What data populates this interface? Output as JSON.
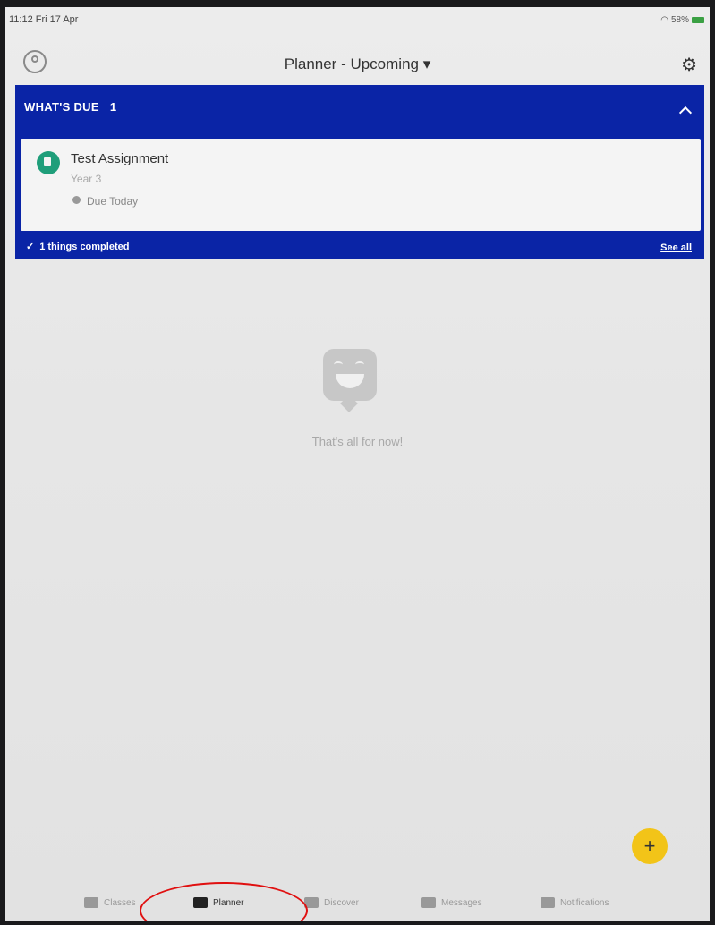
{
  "status_bar": {
    "time": "11:12  Fri 17 Apr",
    "battery": "58%"
  },
  "navbar": {
    "title": "Planner - Upcoming ▾"
  },
  "due_panel": {
    "header": "WHAT'S DUE",
    "count": "1",
    "item": {
      "title": "Test Assignment",
      "subtitle": "Year 3",
      "due": "Due Today"
    },
    "completed": "1 things completed",
    "see_all": "See all"
  },
  "empty_state": {
    "text": "That's all for now!"
  },
  "fab": {
    "label": "+"
  },
  "tabs": [
    {
      "label": "Classes"
    },
    {
      "label": "Planner"
    },
    {
      "label": "Discover"
    },
    {
      "label": "Messages"
    },
    {
      "label": "Notifications"
    }
  ],
  "colors": {
    "panel": "#0a24a6",
    "fab": "#f2c418",
    "card_icon": "#1f9e7a",
    "highlight": "#e01010"
  }
}
